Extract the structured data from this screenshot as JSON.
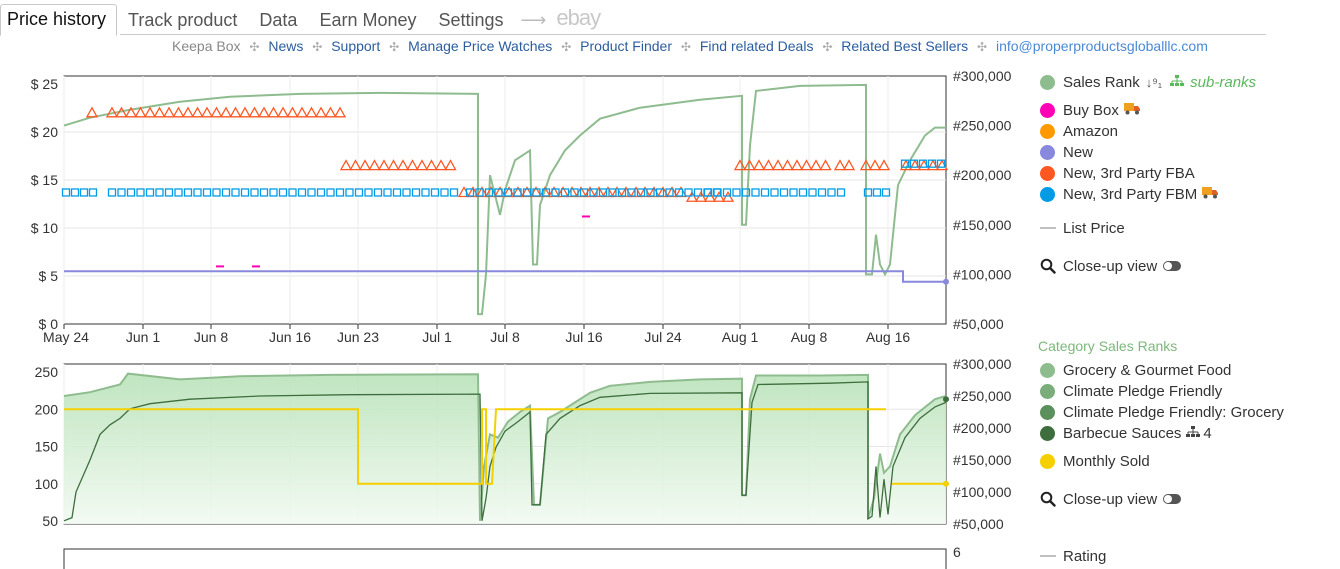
{
  "tabs": [
    {
      "label": "Price history",
      "active": true
    },
    {
      "label": "Track product"
    },
    {
      "label": "Data"
    },
    {
      "label": "Earn Money"
    },
    {
      "label": "Settings"
    }
  ],
  "tab_arrow": "⟶",
  "tab_ebay": "ebay",
  "subnav": {
    "keepa_box": "Keepa Box",
    "links": [
      "News",
      "Support",
      "Manage Price Watches",
      "Product Finder",
      "Find related Deals",
      "Related Best Sellers"
    ],
    "email": "info@properproductsgloballlc.com"
  },
  "chart1": {
    "left_ticks": [
      "$ 25",
      "$ 20",
      "$ 15",
      "$ 10",
      "$ 5",
      "$ 0"
    ],
    "right_ticks": [
      "#300,000",
      "#250,000",
      "#200,000",
      "#150,000",
      "#100,000",
      "#50,000"
    ],
    "x_ticks": [
      "May 24",
      "Jun 1",
      "Jun 8",
      "Jun 16",
      "Jun 23",
      "Jul 1",
      "Jul 8",
      "Jul 16",
      "Jul 24",
      "Aug 1",
      "Aug 8",
      "Aug 16"
    ]
  },
  "chart2": {
    "left_ticks": [
      "250",
      "200",
      "150",
      "100",
      "50"
    ],
    "right_ticks": [
      "#300,000",
      "#250,000",
      "#200,000",
      "#150,000",
      "#100,000",
      "#50,000"
    ]
  },
  "chart3": {
    "right_ticks": [
      "6"
    ]
  },
  "legend1": {
    "sales_rank": "Sales Rank",
    "sub_ranks": "sub-ranks",
    "buy_box": "Buy Box",
    "amazon": "Amazon",
    "new": "New",
    "new_fba": "New, 3rd Party FBA",
    "new_fbm": "New, 3rd Party FBM",
    "list_price": "List Price",
    "close_up": "Close-up view"
  },
  "legend2": {
    "title": "Category Sales Ranks",
    "grocery": "Grocery & Gourmet Food",
    "climate": "Climate Pledge Friendly",
    "climate_grocery": "Climate Pledge Friendly: Grocery",
    "bbq": "Barbecue Sauces",
    "bbq_count": "4",
    "monthly_sold": "Monthly Sold",
    "close_up": "Close-up view"
  },
  "legend3": {
    "rating": "Rating"
  },
  "colors": {
    "sales_rank": "#8fbc8f",
    "buy_box": "#ff00b4",
    "amazon": "#ff9900",
    "new": "#8888dd",
    "new_fba": "#ff5722",
    "new_fbm": "#039be5",
    "grocery": "#8fbc8f",
    "climate": "#7aad7a",
    "climate_grocery": "#5b8f5b",
    "bbq": "#3e6e3e",
    "monthly_sold": "#f5d000"
  },
  "chart_data": [
    {
      "type": "line",
      "ylim": [
        0,
        25
      ],
      "y2lim": [
        50000,
        300000
      ],
      "x": [
        "May 24",
        "Jun 1",
        "Jun 8",
        "Jun 16",
        "Jun 23",
        "Jul 1",
        "Jul 8",
        "Jul 16",
        "Jul 24",
        "Aug 1",
        "Aug 8",
        "Aug 16"
      ],
      "series": [
        {
          "name": "New",
          "values": [
            5.5,
            5.5,
            5.5,
            5.5,
            5.5,
            5.5,
            5.5,
            5.5,
            5.5,
            5.5,
            5.5,
            5.5,
            4.4
          ]
        },
        {
          "name": "New, 3rd Party FBA",
          "values": [
            22,
            22,
            22,
            22,
            16.5,
            16.5,
            13.7,
            13.7,
            13.7,
            16.5,
            16.5,
            16.5,
            16.5
          ]
        },
        {
          "name": "New, 3rd Party FBM",
          "values": [
            13.7,
            13.7,
            13.7,
            13.7,
            13.7,
            13.7,
            13.7,
            13.7,
            13.7,
            13.7,
            13.7,
            13.7,
            16.7
          ]
        },
        {
          "name": "Sales Rank",
          "values": [
            250000,
            265000,
            280000,
            282000,
            283000,
            282000,
            90000,
            230000,
            270000,
            280000,
            285000,
            290000,
            245000
          ]
        }
      ],
      "grid": true
    },
    {
      "type": "area",
      "ylim": [
        50,
        250
      ],
      "y2lim": [
        50000,
        300000
      ],
      "series": [
        {
          "name": "Grocery & Gourmet Food",
          "values": [
            250000,
            272000,
            280000,
            282000,
            283000,
            284000,
            80000,
            240000,
            270000,
            275000,
            280000,
            285000,
            252000
          ]
        },
        {
          "name": "Monthly Sold",
          "values": [
            200,
            200,
            200,
            200,
            100,
            100,
            200,
            200,
            200,
            200,
            200,
            200,
            100
          ]
        }
      ],
      "grid": true
    }
  ]
}
